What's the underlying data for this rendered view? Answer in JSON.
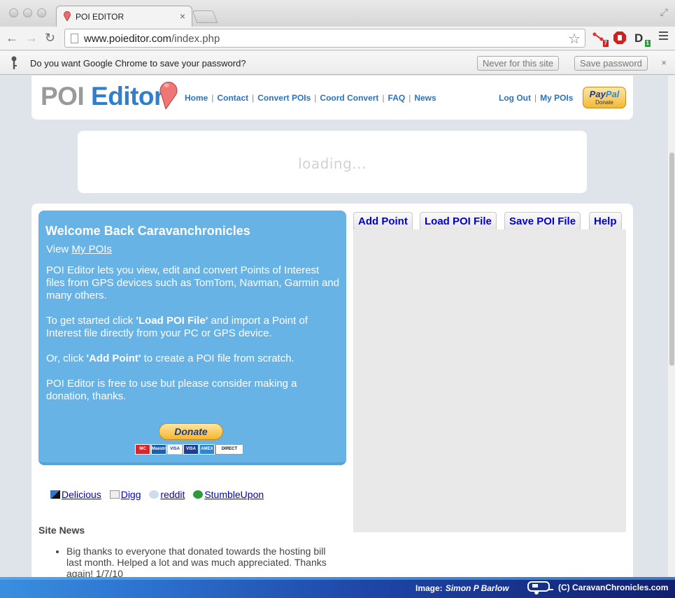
{
  "browser": {
    "tab_title": "POI EDITOR",
    "tab_close": "×",
    "url_host": "www.poieditor.com",
    "url_path": "/index.php",
    "infobar_text": "Do you want Google Chrome to save your password?",
    "never_label": "Never for this site",
    "save_label": "Save password",
    "infobar_close": "×",
    "ext_badges": [
      "7",
      "1"
    ]
  },
  "header": {
    "logo_poi": "POI",
    "logo_editor": "Editor",
    "nav": [
      "Home",
      "Contact",
      "Convert POIs",
      "Coord Convert",
      "FAQ",
      "News"
    ],
    "nav_right": [
      "Log Out",
      "My POIs"
    ],
    "paypal_title_a": "Pay",
    "paypal_title_b": "Pal",
    "paypal_sub": "Donate"
  },
  "loading": "loading...",
  "welcome": {
    "title": "Welcome Back Caravanchronicles",
    "view_prefix": "View ",
    "view_link": "My POIs",
    "para1": "POI Editor lets you view, edit and convert Points of Interest files from GPS devices such as TomTom, Navman, Garmin and many others.",
    "para2_a": "To get started click ",
    "para2_b": "'Load POI File'",
    "para2_c": " and import a Point of Interest file directly from your PC or GPS device.",
    "para3_a": "Or, click ",
    "para3_b": "'Add Point'",
    "para3_c": " to create a POI file from scratch.",
    "para4": "POI Editor is free to use but please consider making a donation, thanks.",
    "donate_label": "Donate",
    "cards": [
      "MC",
      "Maestro",
      "VISA",
      "VISA",
      "AMEX",
      "DIRECT"
    ]
  },
  "social": [
    "Delicious",
    "Digg",
    "reddit",
    "StumbleUpon"
  ],
  "site_news": {
    "title": "Site News",
    "items": [
      "Big thanks to everyone that donated towards the hosting bill last month. Helped a lot and was much appreciated. Thanks again! 1/7/10"
    ]
  },
  "tabs": [
    "Add Point",
    "Load POI File",
    "Save POI File",
    "Help"
  ],
  "footer": {
    "image_label": "Image:",
    "image_author": "Simon P Barlow",
    "copyright": "(C) CaravanChronicles.com"
  },
  "colors": {
    "link_blue": "#2a73c0",
    "welcome_bg": "#68b3e6",
    "tab_link": "#0000cc"
  }
}
